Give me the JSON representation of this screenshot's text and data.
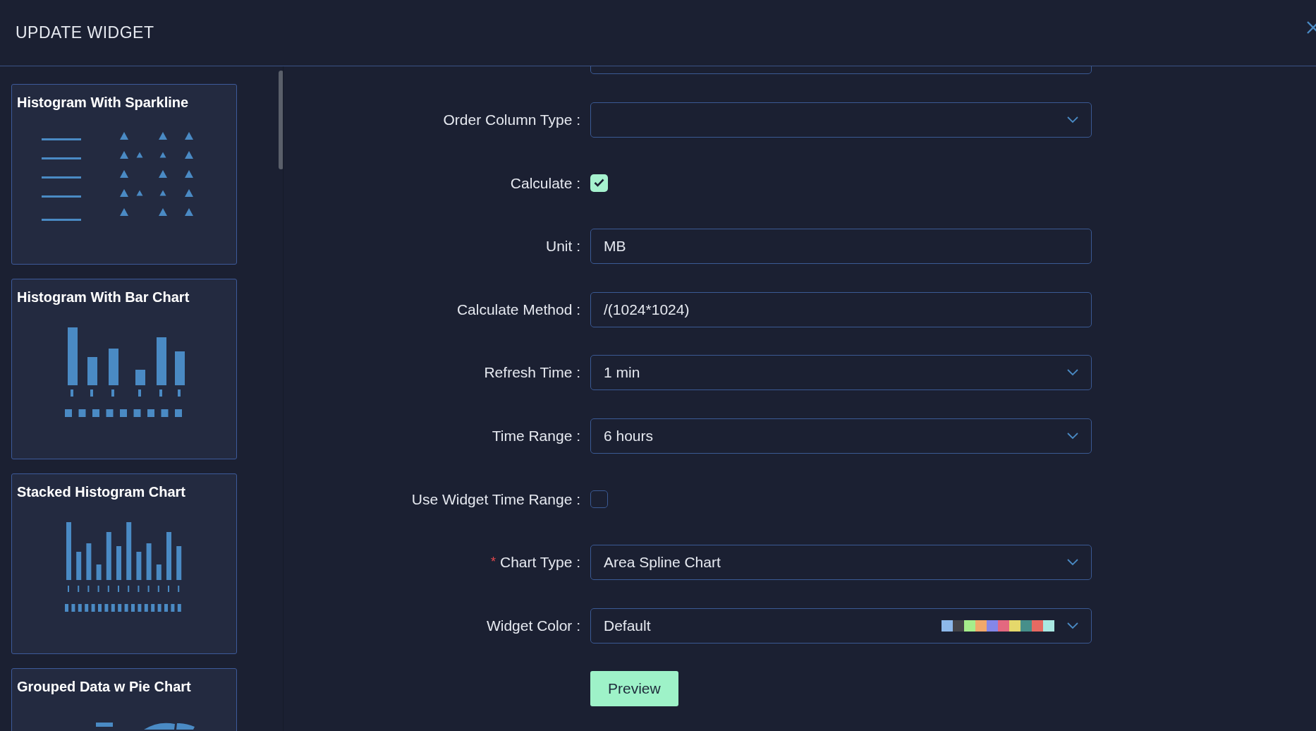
{
  "dialog": {
    "title": "UPDATE WIDGET"
  },
  "widget_types": [
    {
      "title": "Histogram With Sparkline",
      "kind": "sparkline"
    },
    {
      "title": "Histogram With Bar Chart",
      "kind": "bar"
    },
    {
      "title": "Stacked Histogram Chart",
      "kind": "stacked"
    },
    {
      "title": "Grouped Data w Pie Chart",
      "kind": "pie"
    }
  ],
  "form": [
    {
      "label": "Order Column Type :",
      "kind": "select"
    },
    {
      "label": "Calculate :",
      "kind": "checkbox",
      "checked": true
    },
    {
      "label": "Unit :",
      "kind": "input",
      "value": "MB"
    },
    {
      "label": "Calculate Method :",
      "kind": "input",
      "value": "/(1024*1024)"
    },
    {
      "label": "Refresh Time :",
      "kind": "select",
      "value": "1 min"
    },
    {
      "label": "Time Range :",
      "kind": "select",
      "value": "6 hours"
    },
    {
      "label": "Use Widget Time Range :",
      "kind": "checkbox",
      "checked": false
    },
    {
      "label": "Chart Type :",
      "kind": "select",
      "value": "Area Spline Chart",
      "required_mark": "*"
    },
    {
      "label": "Widget Color :",
      "kind": "color-select",
      "value": "Default",
      "palette": [
        {
          "color": "#8db8ea"
        },
        {
          "color": "#434348"
        },
        {
          "color": "#a6ed8b"
        },
        {
          "color": "#f0a86b"
        },
        {
          "color": "#8487e8"
        },
        {
          "color": "#e3687f"
        },
        {
          "color": "#e5d86b"
        },
        {
          "color": "#478f8a"
        },
        {
          "color": "#e76a62"
        },
        {
          "color": "#a9e8e2"
        }
      ]
    }
  ],
  "preview_button": "Preview"
}
